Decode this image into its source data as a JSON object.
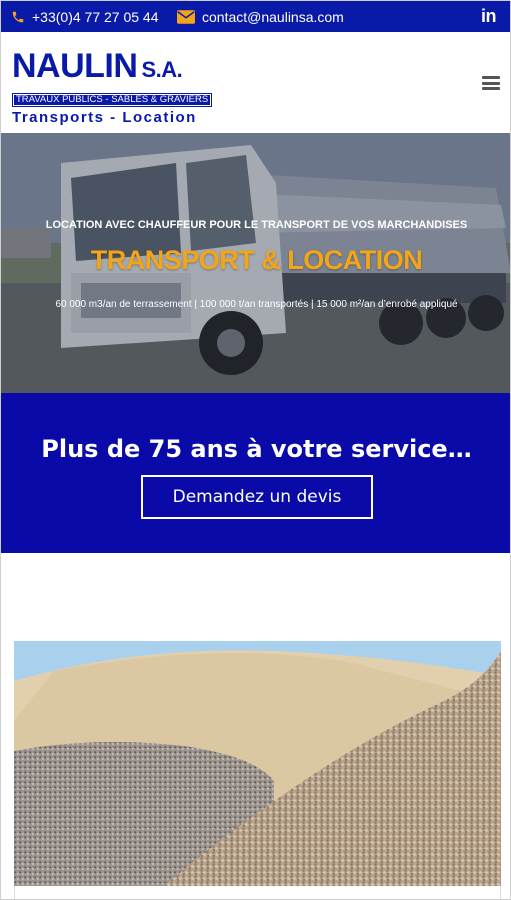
{
  "topbar": {
    "phone": "+33(0)4 77 27 05 44",
    "email": "contact@naulinsa.com",
    "social_icon": "linkedin-icon",
    "social_label": "in"
  },
  "header": {
    "logo_brand": "NAULIN",
    "logo_suffix": "S.A.",
    "logo_tagline": "TRAVAUX PUBLICS - SABLES & GRAVIERS",
    "logo_sub": "Transports - Location",
    "menu_icon": "hamburger-menu-icon"
  },
  "hero": {
    "kicker": "LOCATION AVEC CHAUFFEUR POUR LE TRANSPORT DE VOS MARCHANDISES",
    "title": "TRANSPORT & LOCATION",
    "stats": "60 000 m3/an de terrassement | 100 000 t/an transportés | 15 000 m²/an d’enrobé appliqué"
  },
  "cta": {
    "headline": "Plus de 75 ans à votre service…",
    "button_label": "Demandez un devis"
  },
  "colors": {
    "brand_blue": "#0a1aa8",
    "cta_blue": "#0a0aa8",
    "accent_orange": "#f2a516"
  }
}
